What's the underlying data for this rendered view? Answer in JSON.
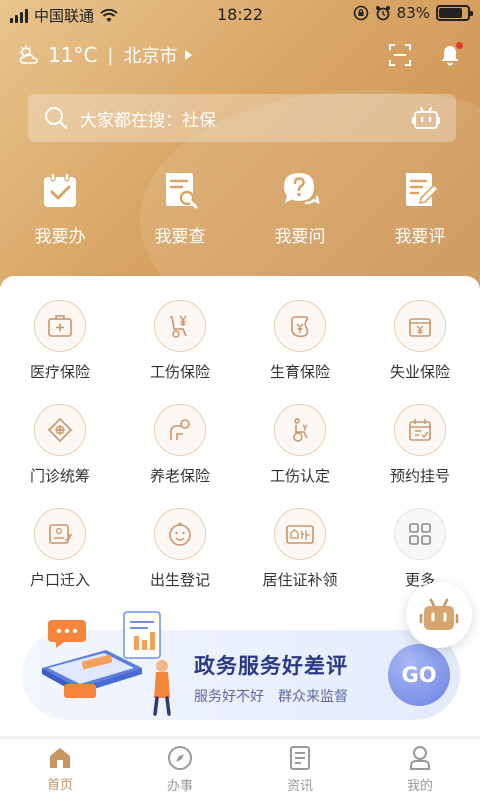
{
  "status_bar": {
    "carrier": "中国联通",
    "time": "18:22",
    "battery": "83%",
    "battery_level": 0.83
  },
  "header": {
    "temperature": "11°C",
    "city": "北京市"
  },
  "search": {
    "placeholder": "大家都在搜：社保"
  },
  "quick_actions": [
    {
      "label": "我要办",
      "icon": "calendar-check-icon"
    },
    {
      "label": "我要查",
      "icon": "document-search-icon"
    },
    {
      "label": "我要问",
      "icon": "question-chat-icon"
    },
    {
      "label": "我要评",
      "icon": "document-edit-icon"
    }
  ],
  "services": [
    {
      "label": "医疗保险",
      "icon": "medical-kit-icon"
    },
    {
      "label": "工伤保险",
      "icon": "wheelchair-yen-icon"
    },
    {
      "label": "生育保险",
      "icon": "baby-bottle-icon"
    },
    {
      "label": "失业保险",
      "icon": "briefcase-yen-icon"
    },
    {
      "label": "门诊统筹",
      "icon": "clinic-cross-icon"
    },
    {
      "label": "养老保险",
      "icon": "elderly-icon"
    },
    {
      "label": "工伤认定",
      "icon": "wheelchair-icon"
    },
    {
      "label": "预约挂号",
      "icon": "appointment-icon"
    },
    {
      "label": "户口迁入",
      "icon": "household-id-icon"
    },
    {
      "label": "出生登记",
      "icon": "baby-face-icon"
    },
    {
      "label": "居住证补领",
      "icon": "residence-card-icon"
    },
    {
      "label": "更多",
      "icon": "grid-more-icon"
    }
  ],
  "banner": {
    "title": "政务服务好差评",
    "subtitle": "服务好不好　群众来监督",
    "button": "GO"
  },
  "tabs": [
    {
      "label": "首页",
      "icon": "home-icon",
      "active": true
    },
    {
      "label": "办事",
      "icon": "compass-icon",
      "active": false
    },
    {
      "label": "资讯",
      "icon": "news-icon",
      "active": false
    },
    {
      "label": "我的",
      "icon": "user-icon",
      "active": false
    }
  ],
  "colors": {
    "accent": "#c99560",
    "hero_gradient_start": "#e9c58e",
    "hero_gradient_end": "#c98f50",
    "banner_title": "#2a3a85",
    "notification_dot": "#e23b2e"
  }
}
